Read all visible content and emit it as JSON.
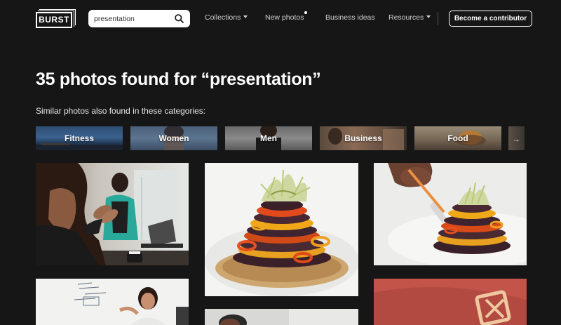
{
  "header": {
    "logo_text": "BURST",
    "search": {
      "value": "presentation",
      "placeholder": ""
    },
    "nav": {
      "collections": "Collections",
      "new_photos": "New photos",
      "business_ideas": "Business ideas",
      "resources": "Resources"
    },
    "contributor_button": "Become a contributor"
  },
  "results": {
    "title": "35 photos found for “presentation”",
    "similar_text": "Similar photos also found in these categories:"
  },
  "categories": [
    "Fitness",
    "Women",
    "Men",
    "Business",
    "Food"
  ],
  "icons": {
    "search": "search-icon",
    "next": "arrow-right-icon",
    "caret": "chevron-down-icon"
  },
  "colors": {
    "background": "#161616",
    "text": "#ffffff",
    "nav_text": "#cfcfcf"
  }
}
